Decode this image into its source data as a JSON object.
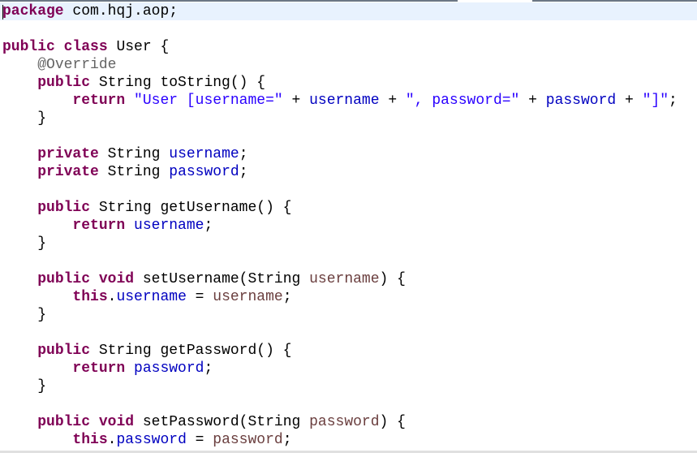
{
  "editor": {
    "current_line": 1,
    "colors": {
      "keyword": "#7f0055",
      "field": "#0000c0",
      "string": "#2a00ff",
      "annotation": "#646464",
      "parameter": "#6a3e3e",
      "current_line_bg": "#e8f2fe"
    },
    "lines": [
      [
        [
          "kw",
          "package"
        ],
        [
          "t",
          " com.hqj.aop;"
        ]
      ],
      [],
      [
        [
          "kw",
          "public"
        ],
        [
          "t",
          " "
        ],
        [
          "kw",
          "class"
        ],
        [
          "t",
          " User {"
        ]
      ],
      [
        [
          "t",
          "    "
        ],
        [
          "ann",
          "@Override"
        ]
      ],
      [
        [
          "t",
          "    "
        ],
        [
          "kw",
          "public"
        ],
        [
          "t",
          " String toString() {"
        ]
      ],
      [
        [
          "t",
          "        "
        ],
        [
          "kw",
          "return"
        ],
        [
          "t",
          " "
        ],
        [
          "str",
          "\"User [username=\""
        ],
        [
          "t",
          " + "
        ],
        [
          "field",
          "username"
        ],
        [
          "t",
          " + "
        ],
        [
          "str",
          "\", password=\""
        ],
        [
          "t",
          " + "
        ],
        [
          "field",
          "password"
        ],
        [
          "t",
          " + "
        ],
        [
          "str",
          "\"]\""
        ],
        [
          "t",
          ";"
        ]
      ],
      [
        [
          "t",
          "    }"
        ]
      ],
      [],
      [
        [
          "t",
          "    "
        ],
        [
          "kw",
          "private"
        ],
        [
          "t",
          " String "
        ],
        [
          "field",
          "username"
        ],
        [
          "t",
          ";"
        ]
      ],
      [
        [
          "t",
          "    "
        ],
        [
          "kw",
          "private"
        ],
        [
          "t",
          " String "
        ],
        [
          "field",
          "password"
        ],
        [
          "t",
          ";"
        ]
      ],
      [],
      [
        [
          "t",
          "    "
        ],
        [
          "kw",
          "public"
        ],
        [
          "t",
          " String getUsername() {"
        ]
      ],
      [
        [
          "t",
          "        "
        ],
        [
          "kw",
          "return"
        ],
        [
          "t",
          " "
        ],
        [
          "field",
          "username"
        ],
        [
          "t",
          ";"
        ]
      ],
      [
        [
          "t",
          "    }"
        ]
      ],
      [],
      [
        [
          "t",
          "    "
        ],
        [
          "kw",
          "public"
        ],
        [
          "t",
          " "
        ],
        [
          "kw",
          "void"
        ],
        [
          "t",
          " setUsername(String "
        ],
        [
          "param",
          "username"
        ],
        [
          "t",
          ") {"
        ]
      ],
      [
        [
          "t",
          "        "
        ],
        [
          "kw",
          "this"
        ],
        [
          "t",
          "."
        ],
        [
          "field",
          "username"
        ],
        [
          "t",
          " = "
        ],
        [
          "param",
          "username"
        ],
        [
          "t",
          ";"
        ]
      ],
      [
        [
          "t",
          "    }"
        ]
      ],
      [],
      [
        [
          "t",
          "    "
        ],
        [
          "kw",
          "public"
        ],
        [
          "t",
          " String getPassword() {"
        ]
      ],
      [
        [
          "t",
          "        "
        ],
        [
          "kw",
          "return"
        ],
        [
          "t",
          " "
        ],
        [
          "field",
          "password"
        ],
        [
          "t",
          ";"
        ]
      ],
      [
        [
          "t",
          "    }"
        ]
      ],
      [],
      [
        [
          "t",
          "    "
        ],
        [
          "kw",
          "public"
        ],
        [
          "t",
          " "
        ],
        [
          "kw",
          "void"
        ],
        [
          "t",
          " setPassword(String "
        ],
        [
          "param",
          "password"
        ],
        [
          "t",
          ") {"
        ]
      ],
      [
        [
          "t",
          "        "
        ],
        [
          "kw",
          "this"
        ],
        [
          "t",
          "."
        ],
        [
          "field",
          "password"
        ],
        [
          "t",
          " = "
        ],
        [
          "param",
          "password"
        ],
        [
          "t",
          ";"
        ]
      ]
    ]
  }
}
